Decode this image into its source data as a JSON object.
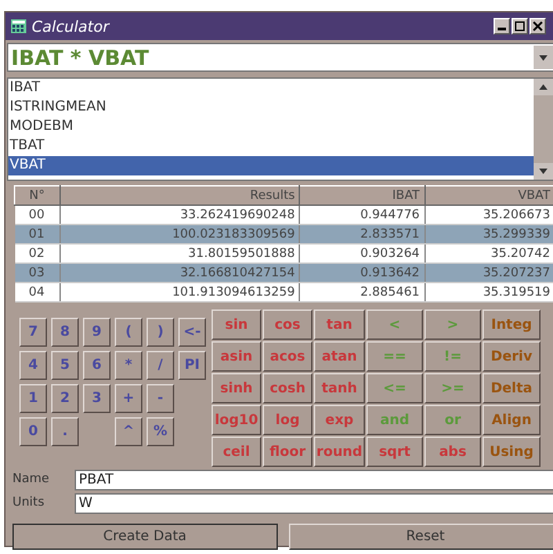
{
  "window": {
    "title": "Calculator"
  },
  "formula": {
    "value": "IBAT * VBAT"
  },
  "variables": [
    {
      "label": "IBAT",
      "selected": false
    },
    {
      "label": "ISTRINGMEAN",
      "selected": false
    },
    {
      "label": "MODEBM",
      "selected": false
    },
    {
      "label": "TBAT",
      "selected": false
    },
    {
      "label": "VBAT",
      "selected": true
    }
  ],
  "table": {
    "columns": [
      "N°",
      "Results",
      "IBAT",
      "VBAT"
    ],
    "rows": [
      [
        "00",
        "33.262419690248",
        "0.944776",
        "35.206673"
      ],
      [
        "01",
        "100.023183309569",
        "2.833571",
        "35.299339"
      ],
      [
        "02",
        "31.80159501888",
        "0.903264",
        "35.20742"
      ],
      [
        "03",
        "32.166810427154",
        "0.913642",
        "35.207237"
      ],
      [
        "04",
        "101.913094613259",
        "2.885461",
        "35.319519"
      ]
    ]
  },
  "keypad": [
    [
      {
        "kind": "digit",
        "label": "7"
      },
      {
        "kind": "digit",
        "label": "8"
      },
      {
        "kind": "digit",
        "label": "9"
      },
      {
        "kind": "digit",
        "label": "("
      },
      {
        "kind": "digit",
        "label": ")"
      },
      {
        "kind": "digit",
        "label": "<-"
      }
    ],
    [
      {
        "kind": "digit",
        "label": "4"
      },
      {
        "kind": "digit",
        "label": "5"
      },
      {
        "kind": "digit",
        "label": "6"
      },
      {
        "kind": "digit",
        "label": "*"
      },
      {
        "kind": "digit",
        "label": "/"
      },
      {
        "kind": "digit",
        "label": "PI"
      }
    ],
    [
      {
        "kind": "digit",
        "label": "1"
      },
      {
        "kind": "digit",
        "label": "2"
      },
      {
        "kind": "digit",
        "label": "3"
      },
      {
        "kind": "digit",
        "label": "+"
      },
      {
        "kind": "digit",
        "label": "-"
      }
    ],
    [
      {
        "kind": "digit",
        "label": "0"
      },
      {
        "kind": "digit",
        "label": "."
      },
      {
        "kind": "blank"
      },
      {
        "kind": "digit",
        "label": "^"
      },
      {
        "kind": "digit",
        "label": "%"
      }
    ]
  ],
  "functions": [
    [
      {
        "kind": "math",
        "label": "sin"
      },
      {
        "kind": "math",
        "label": "cos"
      },
      {
        "kind": "math",
        "label": "tan"
      },
      {
        "kind": "logic",
        "label": "<"
      },
      {
        "kind": "logic",
        "label": ">"
      },
      {
        "kind": "special",
        "label": "Integ"
      }
    ],
    [
      {
        "kind": "math",
        "label": "asin"
      },
      {
        "kind": "math",
        "label": "acos"
      },
      {
        "kind": "math",
        "label": "atan"
      },
      {
        "kind": "logic",
        "label": "=="
      },
      {
        "kind": "logic",
        "label": "!="
      },
      {
        "kind": "special",
        "label": "Deriv"
      }
    ],
    [
      {
        "kind": "math",
        "label": "sinh"
      },
      {
        "kind": "math",
        "label": "cosh"
      },
      {
        "kind": "math",
        "label": "tanh"
      },
      {
        "kind": "logic",
        "label": "<="
      },
      {
        "kind": "logic",
        "label": ">="
      },
      {
        "kind": "special",
        "label": "Delta"
      }
    ],
    [
      {
        "kind": "math",
        "label": "log10"
      },
      {
        "kind": "math",
        "label": "log"
      },
      {
        "kind": "math",
        "label": "exp"
      },
      {
        "kind": "logic",
        "label": "and"
      },
      {
        "kind": "logic",
        "label": "or"
      },
      {
        "kind": "special",
        "label": "Align"
      }
    ],
    [
      {
        "kind": "math",
        "label": "ceil"
      },
      {
        "kind": "math",
        "label": "floor"
      },
      {
        "kind": "math",
        "label": "round"
      },
      {
        "kind": "math",
        "label": "sqrt"
      },
      {
        "kind": "math",
        "label": "abs"
      },
      {
        "kind": "special",
        "label": "Using"
      }
    ]
  ],
  "fields": [
    {
      "label": "Name",
      "value": "PBAT"
    },
    {
      "label": "Units",
      "value": "W"
    }
  ],
  "buttons": [
    "Create Data",
    "Reset"
  ]
}
